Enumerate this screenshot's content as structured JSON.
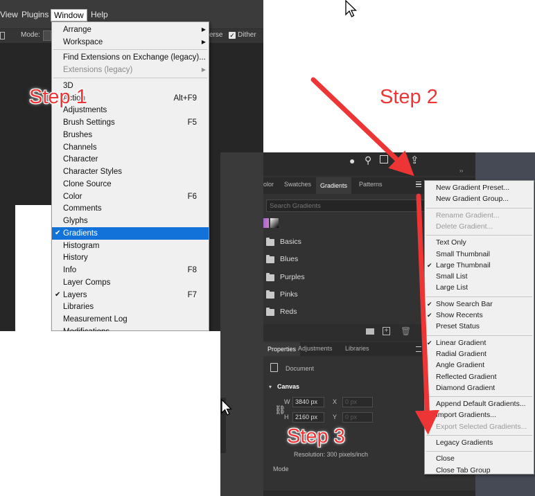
{
  "menubar": {
    "items": [
      "View",
      "Plugins",
      "Window",
      "Help"
    ],
    "active_index": 2
  },
  "optionbar": {
    "mode_label": "Mode:",
    "reverse_label": "erse",
    "dither_label": "Dither",
    "dither_checked": true
  },
  "window_menu": {
    "items": [
      {
        "label": "Arrange",
        "submenu": true
      },
      {
        "label": "Workspace",
        "submenu": true
      },
      {
        "separator": true
      },
      {
        "label": "Find Extensions on Exchange (legacy)..."
      },
      {
        "label": "Extensions (legacy)",
        "submenu": true,
        "disabled": true
      },
      {
        "separator": true
      },
      {
        "label": "3D"
      },
      {
        "label": "Action",
        "shortcut": "Alt+F9"
      },
      {
        "label": "Adjustments"
      },
      {
        "label": "Brush Settings",
        "shortcut": "F5"
      },
      {
        "label": "Brushes"
      },
      {
        "label": "Channels"
      },
      {
        "label": "Character"
      },
      {
        "label": "Character Styles"
      },
      {
        "label": "Clone Source"
      },
      {
        "label": "Color",
        "shortcut": "F6"
      },
      {
        "label": "Comments"
      },
      {
        "label": "Glyphs"
      },
      {
        "label": "Gradients",
        "checked": true,
        "selected": true
      },
      {
        "label": "Histogram"
      },
      {
        "label": "History"
      },
      {
        "label": "Info",
        "shortcut": "F8"
      },
      {
        "label": "Layer Comps"
      },
      {
        "label": "Layers",
        "shortcut": "F7",
        "checked": true
      },
      {
        "label": "Libraries"
      },
      {
        "label": "Measurement Log"
      },
      {
        "label": "Modifications"
      }
    ]
  },
  "panel_tabs": [
    "olor",
    "Swatches",
    "Gradients",
    "Patterns"
  ],
  "gradients_panel": {
    "search_placeholder": "Search Gradients",
    "folders": [
      "Basics",
      "Blues",
      "Purples",
      "Pinks",
      "Reds"
    ]
  },
  "properties_panel": {
    "tabs": [
      "Properties",
      "Adjustments",
      "Libraries"
    ],
    "doc_label": "Document",
    "section": "Canvas",
    "w_label": "W",
    "w_value": "3840 px",
    "h_label": "H",
    "h_value": "2160 px",
    "x_label": "X",
    "x_value": "0 px",
    "y_label": "Y",
    "y_value": "0 px",
    "resolution": "Resolution: 300 pixels/inch",
    "mode_label": "Mode"
  },
  "flyout_menu": {
    "items": [
      {
        "label": "New Gradient Preset..."
      },
      {
        "label": "New Gradient Group..."
      },
      {
        "separator": true
      },
      {
        "label": "Rename Gradient...",
        "disabled": true
      },
      {
        "label": "Delete Gradient...",
        "disabled": true
      },
      {
        "separator": true
      },
      {
        "label": "Text Only"
      },
      {
        "label": "Small Thumbnail"
      },
      {
        "label": "Large Thumbnail",
        "checked": true
      },
      {
        "label": "Small List"
      },
      {
        "label": "Large List"
      },
      {
        "separator": true
      },
      {
        "label": "Show Search Bar",
        "checked": true
      },
      {
        "label": "Show Recents",
        "checked": true
      },
      {
        "label": "Preset Status"
      },
      {
        "separator": true
      },
      {
        "label": "Linear Gradient",
        "checked": true
      },
      {
        "label": "Radial Gradient"
      },
      {
        "label": "Angle Gradient"
      },
      {
        "label": "Reflected Gradient"
      },
      {
        "label": "Diamond Gradient"
      },
      {
        "separator": true
      },
      {
        "label": "Append Default Gradients..."
      },
      {
        "label": "Import Gradients..."
      },
      {
        "label": "Export Selected Gradients...",
        "disabled": true
      },
      {
        "separator": true
      },
      {
        "label": "Legacy Gradients"
      },
      {
        "separator": true
      },
      {
        "label": "Close"
      },
      {
        "label": "Close Tab Group"
      }
    ]
  },
  "annotations": {
    "step1": "Step 1",
    "step2": "Step 2",
    "step3": "Step 3",
    "color": "#ee3535"
  },
  "colors": {
    "selection": "#1272d9",
    "panel_bg": "#323232",
    "menu_bg": "#f0f0f0",
    "teal_accent": "#6cc4c4"
  }
}
